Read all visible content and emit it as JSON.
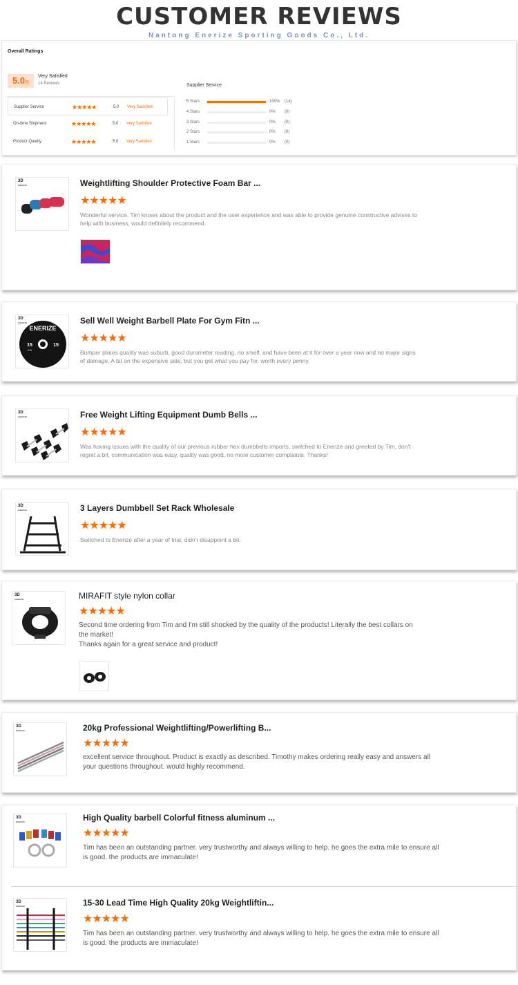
{
  "header": {
    "title": "CUSTOMER REVIEWS",
    "company": "Nantong Enerize Sporting Goods Co., Ltd."
  },
  "overall": {
    "label": "Overall Ratings",
    "score": "5.0",
    "score_suffix": "/5",
    "satisfaction": "Very Satisfied",
    "review_count": "14 Reviews",
    "categories": [
      {
        "label": "Supplier Service",
        "stars": "★★★★★",
        "score": "5.0",
        "verdict": "Very Satisfied"
      },
      {
        "label": "On-time Shipment",
        "stars": "★★★★★",
        "score": "5.0",
        "verdict": "Very Satisfied"
      },
      {
        "label": "Product Quality",
        "stars": "★★★★★",
        "score": "5.0",
        "verdict": "Very Satisfied"
      }
    ],
    "breakdown_title": "Supplier Service",
    "breakdown": [
      {
        "label": "5 Stars",
        "percent": "100%",
        "count": "(14)",
        "fraction": 1
      },
      {
        "label": "4 Stars",
        "percent": "0%",
        "count": "(0)",
        "fraction": 0
      },
      {
        "label": "3 Stars",
        "percent": "0%",
        "count": "(0)",
        "fraction": 0
      },
      {
        "label": "2 Stars",
        "percent": "0%",
        "count": "(0)",
        "fraction": 0
      },
      {
        "label": "1 Stars",
        "percent": "0%",
        "count": "(0)",
        "fraction": 0
      }
    ]
  },
  "brand_mark": "3D",
  "brand_small": "ENERIZE",
  "reviews": [
    {
      "title": "Weightlifting Shoulder Protective Foam Bar ...",
      "stars": "★★★★★",
      "text": "Wonderful service, Tim knows about the product and the user experience and was able to provide genuine constructive advises to help with business, would definitely recommend.",
      "icon": "foam-pad-icon"
    },
    {
      "title": "Sell Well Weight Barbell Plate For Gym Fitn  ...",
      "stars": "★★★★★",
      "text": "Bumper plates quality was suburb, good durometer reading, no smell, and have been at it for over a year now and no major signs of damage. A bit on the expensive side, but you get what you pay for, worth every penny.",
      "icon": "bumper-plate-icon",
      "plate_text": "ENERIZE",
      "plate_weight": "15",
      "plate_unit": "KG"
    },
    {
      "title": "Free Weight Lifting Equipment Dumb Bells  ...",
      "stars": "★★★★★",
      "text": "Was having issues with the quality of our previous rubber hex dumbbells imports, switched to Enerize and greeted by Tim, don't regret a bit, communication was easy, quality was good, no more customer complaints. Thanks!",
      "icon": "dumbbell-icon"
    },
    {
      "title": "3 Layers Dumbbell Set Rack Wholesale",
      "stars": "★★★★★",
      "text": "Switched to Enerize after a year of trial, didn't disappoint a bit.",
      "icon": "rack-icon"
    },
    {
      "title": "MIRAFIT style nylon collar",
      "stars": "★★★★★",
      "text": "Second time ordering from Tim and I'm still shocked by the quality of the products! Literally the best collars on the market!",
      "text2": "Thanks again for a great service and product!",
      "icon": "collar-icon"
    },
    {
      "title": "20kg Professional Weightlifting/Powerlifting B...",
      "stars": "★★★★★",
      "text": "excellent service throughout. Product is exactly as described. Timothy makes ordering really easy and answers all your questions throughout. would highly recommend.",
      "icon": "barbell-icon"
    },
    {
      "title": "High Quality barbell Colorful fitness aluminum ...",
      "stars": "★★★★★",
      "text": "Tim has been an outstanding partner. very trustworthy and always willing to help. he goes the extra mile to ensure all is good. the products are immaculate!",
      "icon": "colorful-collar-icon"
    },
    {
      "title": "15-30 Lead Time High Quality 20kg Weightliftin...",
      "stars": "★★★★★",
      "text": "Tim has been an outstanding partner. very trustworthy and always willing to help. he goes the extra mile to ensure all is good. the products are immaculate!",
      "icon": "bar-rack-icon"
    }
  ]
}
